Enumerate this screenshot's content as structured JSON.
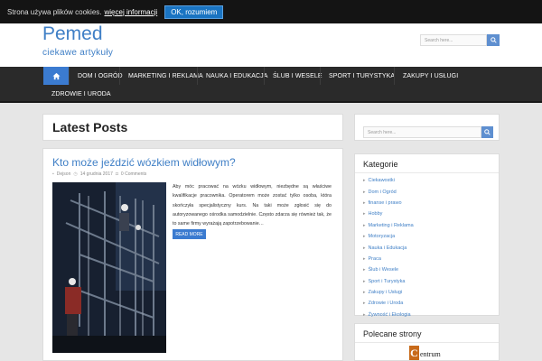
{
  "cookie": {
    "text": "Strona używa plików cookies.",
    "more": "więcej informacji",
    "ok": "OK, rozumiem"
  },
  "site": {
    "title": "Pemed",
    "tagline": "ciekawe artykuły"
  },
  "header_search": {
    "placeholder": "Search here..."
  },
  "nav": {
    "home_icon": "home-icon",
    "items": [
      "DOM I OGRÓD",
      "MARKETING I REKLAMA",
      "NAUKA I EDUKACJA",
      "ŚLUB I WESELE",
      "SPORT I TURYSTYKA",
      "ZAKUPY I USŁUGI",
      "ZDROWIE I URODA"
    ]
  },
  "main": {
    "heading": "Latest Posts"
  },
  "post": {
    "title": "Kto może jeździć wózkiem widłowym?",
    "author": "Dejson",
    "date": "14 grudnia 2017",
    "comments": "0 Comments",
    "excerpt": "Aby móc pracować na wózku widłowym, niezbędne są właściwe kwalifikacje pracownika. Operatorem może zostać tylko osoba, która skończyła specjalistyczny kurs. Na taki może zgłosić się do autoryzowanego ośrodka samodzielnie. Często zdarza się również tak, że to same firmy wyrażają zapotrzebowanie…",
    "read_more": "READ MORE"
  },
  "sidebar": {
    "search_placeholder": "Search here...",
    "categories_title": "Kategorie",
    "categories": [
      "Ciekawostki",
      "Dom i Ogród",
      "finanse i prawo",
      "Hobby",
      "Marketing i Reklama",
      "Motoryzacja",
      "Nauka i Edukacja",
      "Praca",
      "Ślub i Wesele",
      "Sport i Turystyka",
      "Zakupy i Usługi",
      "Zdrowie i Uroda",
      "Żywność i Ekologia"
    ],
    "recommended_title": "Polecane strony",
    "recommended_logo_initial": "C",
    "recommended_logo_rest": "entrum"
  },
  "colors": {
    "accent": "#3b7bd0",
    "link": "#3f7fc6",
    "nav_bg": "#2a2a2a",
    "page_bg": "#e6e6e6"
  }
}
